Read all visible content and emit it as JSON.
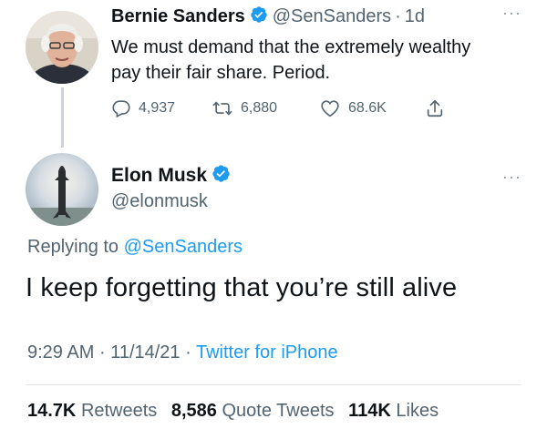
{
  "parent_tweet": {
    "author_name": "Bernie Sanders",
    "handle": "@SenSanders",
    "separator": "·",
    "time": "1d",
    "more": "···",
    "text": "We must demand that the extremely wealthy pay their fair share. Period.",
    "replies": "4,937",
    "retweets": "6,880",
    "likes": "68.6K"
  },
  "main_tweet": {
    "author_name": "Elon Musk",
    "handle": "@elonmusk",
    "more": "···",
    "replying_prefix": "Replying to",
    "replying_to": "@SenSanders",
    "text": "I keep forgetting that you’re still alive",
    "time": "9:29 AM",
    "separator": "·",
    "date": "11/14/21",
    "source": "Twitter for iPhone",
    "stats": {
      "retweets_count": "14.7K",
      "retweets_label": "Retweets",
      "quotes_count": "8,586",
      "quotes_label": "Quote Tweets",
      "likes_count": "114K",
      "likes_label": "Likes"
    }
  },
  "colors": {
    "accent": "#1d9bf0",
    "muted": "#536471",
    "text": "#0f1419",
    "verified": "#1d9bf0"
  },
  "icons": [
    "reply-icon",
    "retweet-icon",
    "like-icon",
    "share-icon",
    "verified-badge-icon",
    "more-icon"
  ]
}
